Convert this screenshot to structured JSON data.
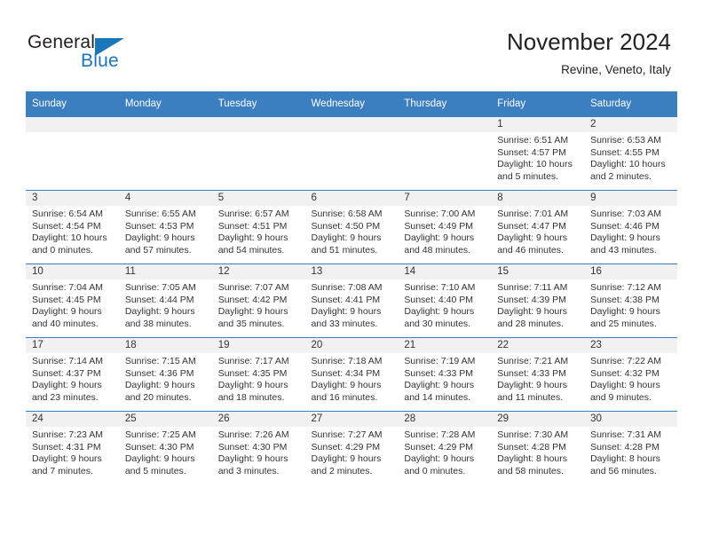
{
  "logo": {
    "word1": "General",
    "word2": "Blue",
    "triangle_color": "#1b75bb",
    "icon": "general-blue-logo"
  },
  "header": {
    "title": "November 2024",
    "subtitle": "Revine, Veneto, Italy"
  },
  "colors": {
    "header_blue": "#3c7fc1",
    "daynum_strip": "#f1f1f1",
    "text": "#333333",
    "brand_blue": "#1b75bb"
  },
  "calendar": {
    "weekday_headers": [
      "Sunday",
      "Monday",
      "Tuesday",
      "Wednesday",
      "Thursday",
      "Friday",
      "Saturday"
    ],
    "weeks": [
      [
        {
          "day": "",
          "lines": []
        },
        {
          "day": "",
          "lines": []
        },
        {
          "day": "",
          "lines": []
        },
        {
          "day": "",
          "lines": []
        },
        {
          "day": "",
          "lines": []
        },
        {
          "day": "1",
          "lines": [
            "Sunrise: 6:51 AM",
            "Sunset: 4:57 PM",
            "Daylight: 10 hours",
            "and 5 minutes."
          ]
        },
        {
          "day": "2",
          "lines": [
            "Sunrise: 6:53 AM",
            "Sunset: 4:55 PM",
            "Daylight: 10 hours",
            "and 2 minutes."
          ]
        }
      ],
      [
        {
          "day": "3",
          "lines": [
            "Sunrise: 6:54 AM",
            "Sunset: 4:54 PM",
            "Daylight: 10 hours",
            "and 0 minutes."
          ]
        },
        {
          "day": "4",
          "lines": [
            "Sunrise: 6:55 AM",
            "Sunset: 4:53 PM",
            "Daylight: 9 hours",
            "and 57 minutes."
          ]
        },
        {
          "day": "5",
          "lines": [
            "Sunrise: 6:57 AM",
            "Sunset: 4:51 PM",
            "Daylight: 9 hours",
            "and 54 minutes."
          ]
        },
        {
          "day": "6",
          "lines": [
            "Sunrise: 6:58 AM",
            "Sunset: 4:50 PM",
            "Daylight: 9 hours",
            "and 51 minutes."
          ]
        },
        {
          "day": "7",
          "lines": [
            "Sunrise: 7:00 AM",
            "Sunset: 4:49 PM",
            "Daylight: 9 hours",
            "and 48 minutes."
          ]
        },
        {
          "day": "8",
          "lines": [
            "Sunrise: 7:01 AM",
            "Sunset: 4:47 PM",
            "Daylight: 9 hours",
            "and 46 minutes."
          ]
        },
        {
          "day": "9",
          "lines": [
            "Sunrise: 7:03 AM",
            "Sunset: 4:46 PM",
            "Daylight: 9 hours",
            "and 43 minutes."
          ]
        }
      ],
      [
        {
          "day": "10",
          "lines": [
            "Sunrise: 7:04 AM",
            "Sunset: 4:45 PM",
            "Daylight: 9 hours",
            "and 40 minutes."
          ]
        },
        {
          "day": "11",
          "lines": [
            "Sunrise: 7:05 AM",
            "Sunset: 4:44 PM",
            "Daylight: 9 hours",
            "and 38 minutes."
          ]
        },
        {
          "day": "12",
          "lines": [
            "Sunrise: 7:07 AM",
            "Sunset: 4:42 PM",
            "Daylight: 9 hours",
            "and 35 minutes."
          ]
        },
        {
          "day": "13",
          "lines": [
            "Sunrise: 7:08 AM",
            "Sunset: 4:41 PM",
            "Daylight: 9 hours",
            "and 33 minutes."
          ]
        },
        {
          "day": "14",
          "lines": [
            "Sunrise: 7:10 AM",
            "Sunset: 4:40 PM",
            "Daylight: 9 hours",
            "and 30 minutes."
          ]
        },
        {
          "day": "15",
          "lines": [
            "Sunrise: 7:11 AM",
            "Sunset: 4:39 PM",
            "Daylight: 9 hours",
            "and 28 minutes."
          ]
        },
        {
          "day": "16",
          "lines": [
            "Sunrise: 7:12 AM",
            "Sunset: 4:38 PM",
            "Daylight: 9 hours",
            "and 25 minutes."
          ]
        }
      ],
      [
        {
          "day": "17",
          "lines": [
            "Sunrise: 7:14 AM",
            "Sunset: 4:37 PM",
            "Daylight: 9 hours",
            "and 23 minutes."
          ]
        },
        {
          "day": "18",
          "lines": [
            "Sunrise: 7:15 AM",
            "Sunset: 4:36 PM",
            "Daylight: 9 hours",
            "and 20 minutes."
          ]
        },
        {
          "day": "19",
          "lines": [
            "Sunrise: 7:17 AM",
            "Sunset: 4:35 PM",
            "Daylight: 9 hours",
            "and 18 minutes."
          ]
        },
        {
          "day": "20",
          "lines": [
            "Sunrise: 7:18 AM",
            "Sunset: 4:34 PM",
            "Daylight: 9 hours",
            "and 16 minutes."
          ]
        },
        {
          "day": "21",
          "lines": [
            "Sunrise: 7:19 AM",
            "Sunset: 4:33 PM",
            "Daylight: 9 hours",
            "and 14 minutes."
          ]
        },
        {
          "day": "22",
          "lines": [
            "Sunrise: 7:21 AM",
            "Sunset: 4:33 PM",
            "Daylight: 9 hours",
            "and 11 minutes."
          ]
        },
        {
          "day": "23",
          "lines": [
            "Sunrise: 7:22 AM",
            "Sunset: 4:32 PM",
            "Daylight: 9 hours",
            "and 9 minutes."
          ]
        }
      ],
      [
        {
          "day": "24",
          "lines": [
            "Sunrise: 7:23 AM",
            "Sunset: 4:31 PM",
            "Daylight: 9 hours",
            "and 7 minutes."
          ]
        },
        {
          "day": "25",
          "lines": [
            "Sunrise: 7:25 AM",
            "Sunset: 4:30 PM",
            "Daylight: 9 hours",
            "and 5 minutes."
          ]
        },
        {
          "day": "26",
          "lines": [
            "Sunrise: 7:26 AM",
            "Sunset: 4:30 PM",
            "Daylight: 9 hours",
            "and 3 minutes."
          ]
        },
        {
          "day": "27",
          "lines": [
            "Sunrise: 7:27 AM",
            "Sunset: 4:29 PM",
            "Daylight: 9 hours",
            "and 2 minutes."
          ]
        },
        {
          "day": "28",
          "lines": [
            "Sunrise: 7:28 AM",
            "Sunset: 4:29 PM",
            "Daylight: 9 hours",
            "and 0 minutes."
          ]
        },
        {
          "day": "29",
          "lines": [
            "Sunrise: 7:30 AM",
            "Sunset: 4:28 PM",
            "Daylight: 8 hours",
            "and 58 minutes."
          ]
        },
        {
          "day": "30",
          "lines": [
            "Sunrise: 7:31 AM",
            "Sunset: 4:28 PM",
            "Daylight: 8 hours",
            "and 56 minutes."
          ]
        }
      ]
    ]
  }
}
